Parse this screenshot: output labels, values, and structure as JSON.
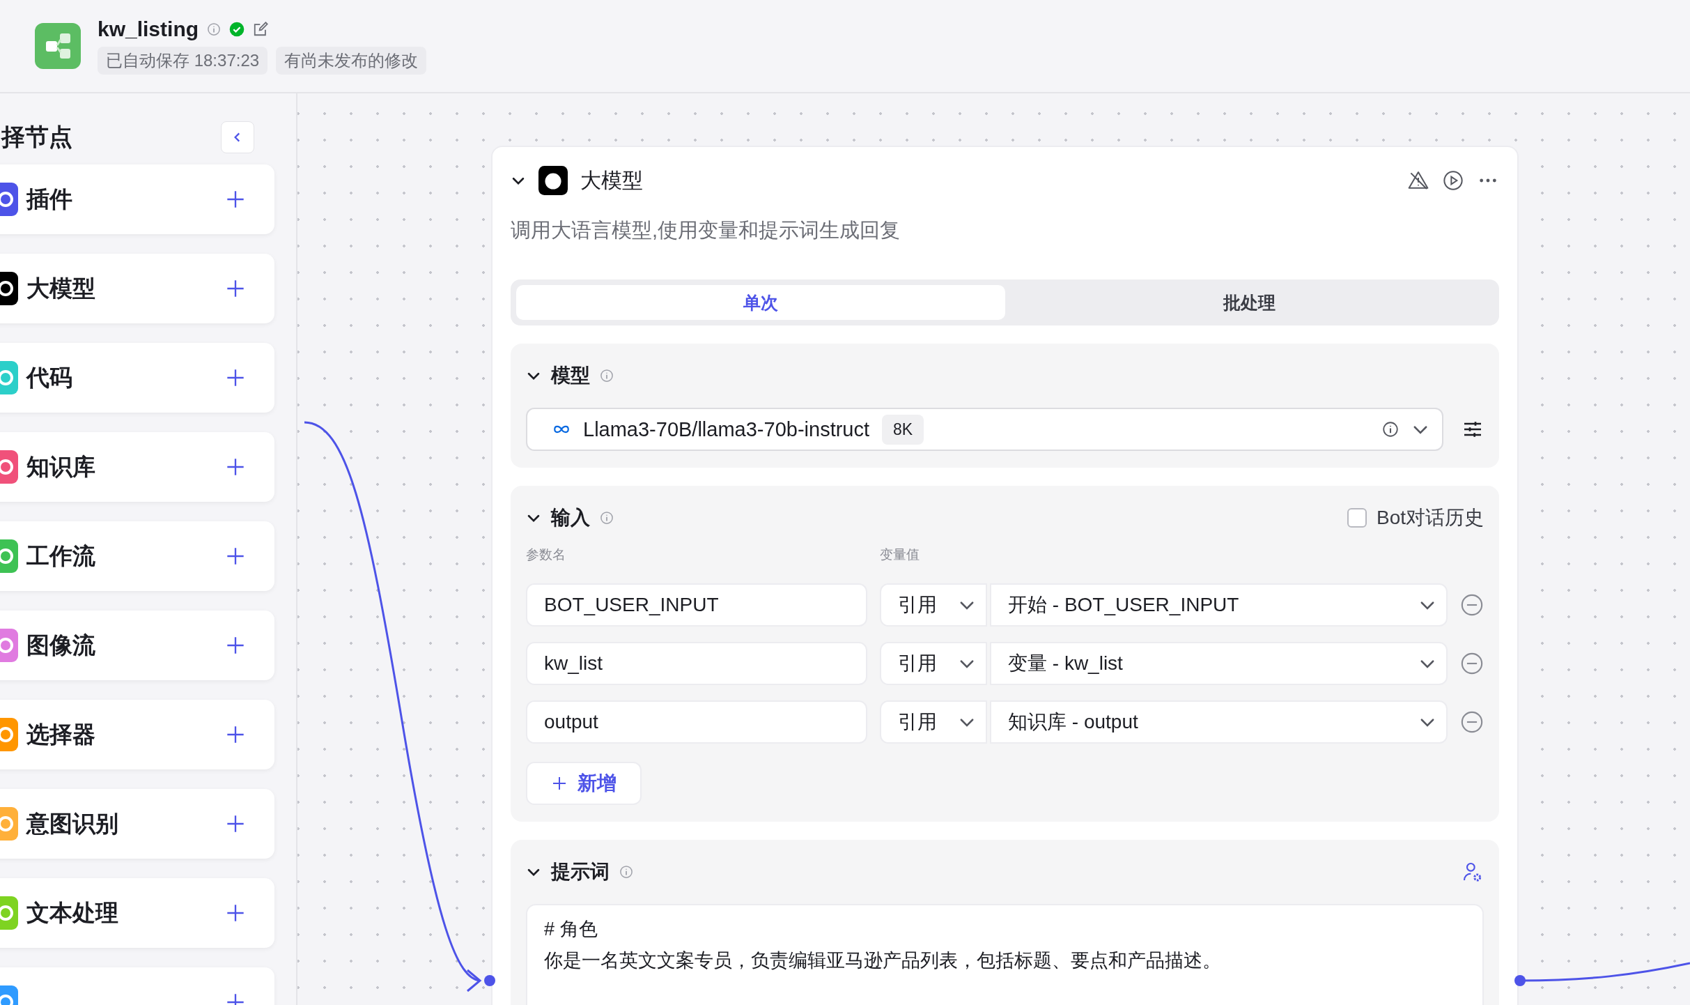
{
  "header": {
    "title": "kw_listing",
    "verified": true,
    "autosave": "已自动保存 18:37:23",
    "unpublished": "有尚未发布的修改"
  },
  "sidebar": {
    "title": "择节点",
    "items": [
      {
        "label": "插件",
        "color": "#4d53e8"
      },
      {
        "label": "大模型",
        "color": "#000000"
      },
      {
        "label": "代码",
        "color": "#2ccfc9"
      },
      {
        "label": "知识库",
        "color": "#f0517a"
      },
      {
        "label": "工作流",
        "color": "#3ec254"
      },
      {
        "label": "图像流",
        "color": "#e07be0"
      },
      {
        "label": "选择器",
        "color": "#ff9600"
      },
      {
        "label": "意图识别",
        "color": "#ffb03a"
      },
      {
        "label": "文本处理",
        "color": "#7ed321"
      },
      {
        "color": "#2f9bff"
      }
    ]
  },
  "node": {
    "title": "大模型",
    "description": "调用大语言模型,使用变量和提示词生成回复",
    "expanded": true,
    "tabs": [
      {
        "label": "单次",
        "selected": true
      },
      {
        "label": "批处理",
        "selected": false
      }
    ],
    "model": {
      "title": "模型",
      "expanded": true,
      "name": "Llama3-70B/llama3-70b-instruct",
      "context": "8K"
    },
    "inputs": {
      "title": "输入",
      "expanded": true,
      "history_label": "Bot对话历史",
      "history_checked": false,
      "col_name": "参数名",
      "col_value": "变量值",
      "rows": [
        {
          "name": "BOT_USER_INPUT",
          "mode": "引用",
          "value": "开始 - BOT_USER_INPUT"
        },
        {
          "name": "kw_list",
          "mode": "引用",
          "value": "变量 - kw_list"
        },
        {
          "name": "output",
          "mode": "引用",
          "value": "知识库 - output"
        }
      ],
      "add_label": "新增"
    },
    "prompt": {
      "title": "提示词",
      "expanded": true,
      "lines": [
        "# 角色",
        "你是一名英文文案专员，负责编辑亚马逊产品列表，包括标题、要点和产品描述。"
      ]
    }
  }
}
